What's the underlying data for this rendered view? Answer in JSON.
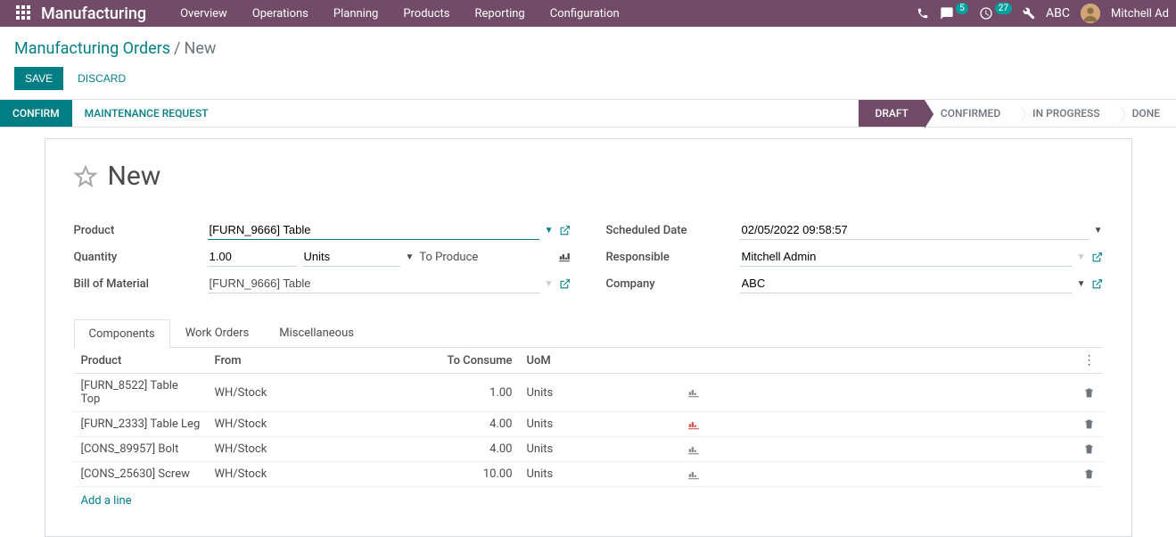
{
  "navbar": {
    "app_title": "Manufacturing",
    "menu": [
      "Overview",
      "Operations",
      "Planning",
      "Products",
      "Reporting",
      "Configuration"
    ],
    "messages_badge": "5",
    "activities_badge": "27",
    "company": "ABC",
    "user_name": "Mitchell Ad"
  },
  "breadcrumb": {
    "parent": "Manufacturing Orders",
    "current": "New"
  },
  "actions": {
    "save": "SAVE",
    "discard": "DISCARD"
  },
  "statusbar": {
    "confirm": "CONFIRM",
    "maintenance": "MAINTENANCE REQUEST",
    "steps": [
      "DRAFT",
      "CONFIRMED",
      "IN PROGRESS",
      "DONE"
    ],
    "active_step": "DRAFT"
  },
  "form": {
    "title": "New",
    "product_label": "Product",
    "product_value": "[FURN_9666] Table",
    "quantity_label": "Quantity",
    "quantity_value": "1.00",
    "quantity_uom": "Units",
    "quantity_suffix": "To Produce",
    "bom_label": "Bill of Material",
    "bom_value": "[FURN_9666] Table",
    "scheduled_label": "Scheduled Date",
    "scheduled_value": "02/05/2022 09:58:57",
    "responsible_label": "Responsible",
    "responsible_value": "Mitchell Admin",
    "company_label": "Company",
    "company_value": "ABC"
  },
  "tabs": [
    "Components",
    "Work Orders",
    "Miscellaneous"
  ],
  "table": {
    "headers": {
      "product": "Product",
      "from": "From",
      "to_consume": "To Consume",
      "uom": "UoM"
    },
    "rows": [
      {
        "product": "[FURN_8522] Table Top",
        "from": "WH/Stock",
        "to_consume": "1.00",
        "uom": "Units",
        "warn": false
      },
      {
        "product": "[FURN_2333] Table Leg",
        "from": "WH/Stock",
        "to_consume": "4.00",
        "uom": "Units",
        "warn": true
      },
      {
        "product": "[CONS_89957] Bolt",
        "from": "WH/Stock",
        "to_consume": "4.00",
        "uom": "Units",
        "warn": false
      },
      {
        "product": "[CONS_25630] Screw",
        "from": "WH/Stock",
        "to_consume": "10.00",
        "uom": "Units",
        "warn": false
      }
    ],
    "add_line": "Add a line"
  }
}
